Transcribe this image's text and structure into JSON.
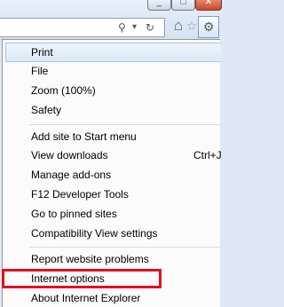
{
  "window": {
    "minimize_glyph": "_",
    "maximize_glyph": "□",
    "close_glyph": "✕"
  },
  "toolbar": {
    "search_icon": "⚲",
    "dropdown_icon": "▾",
    "refresh_icon": "↻",
    "home_icon": "⌂",
    "favorites_icon": "☆",
    "tools_icon": "⚙"
  },
  "menu": {
    "items": [
      {
        "label": "Print"
      },
      {
        "label": "File"
      },
      {
        "label": "Zoom (100%)"
      },
      {
        "label": "Safety"
      },
      {
        "label": "Add site to Start menu"
      },
      {
        "label": "View downloads",
        "shortcut": "Ctrl+J"
      },
      {
        "label": "Manage add-ons"
      },
      {
        "label": "F12 Developer Tools"
      },
      {
        "label": "Go to pinned sites"
      },
      {
        "label": "Compatibility View settings"
      },
      {
        "label": "Report website problems"
      },
      {
        "label": "Internet options"
      },
      {
        "label": "About Internet Explorer"
      }
    ]
  },
  "highlight_color": "#e3101e"
}
